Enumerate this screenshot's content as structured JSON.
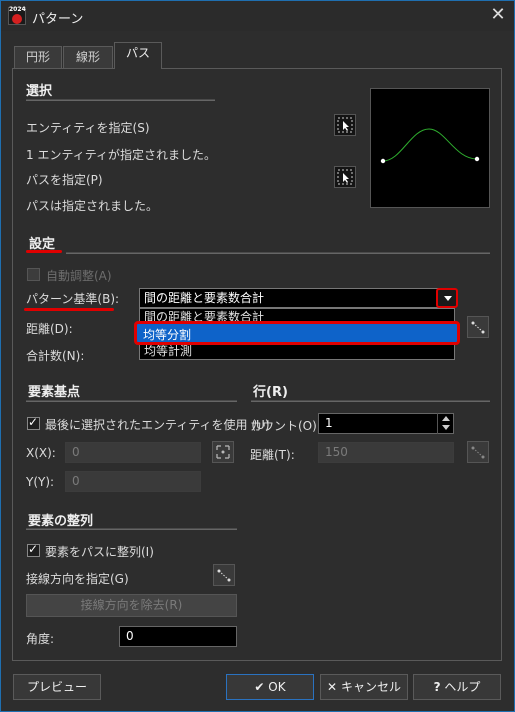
{
  "window": {
    "title": "パターン",
    "app_year": "2024"
  },
  "tabs": [
    {
      "label": "円形"
    },
    {
      "label": "線形"
    },
    {
      "label": "パス"
    }
  ],
  "selection": {
    "heading": "選択",
    "entity_label": "エンティティを指定(S)",
    "entity_status": "1 エンティティが指定されました。",
    "path_label": "パスを指定(P)",
    "path_status": "パスは指定されました。"
  },
  "settings": {
    "heading": "設定",
    "auto_adjust": "自動調整(A)",
    "pattern_basis_label": "パターン基準(B):",
    "pattern_basis_value": "間の距離と要素数合計",
    "options": [
      "間の距離と要素数合計",
      "均等分割",
      "均等計測"
    ],
    "highlighted_option": "均等分割",
    "distance_label": "距離(D):",
    "total_label": "合計数(N):"
  },
  "base_point": {
    "heading": "要素基点",
    "use_last": "最後に選択されたエンティティを使用 (U)",
    "x_label": "X(X):",
    "x_value": "0",
    "y_label": "Y(Y):",
    "y_value": "0"
  },
  "row": {
    "heading": "行(R)",
    "count_label": "カウント(O):",
    "count_value": "1",
    "distance_label": "距離(T):",
    "distance_value": "150"
  },
  "alignment": {
    "heading": "要素の整列",
    "align_to_path": "要素をパスに整列(I)",
    "tangent_label": "接線方向を指定(G)",
    "remove_tangent": "接線方向を除去(R)",
    "angle_label": "角度:",
    "angle_value": "0"
  },
  "buttons": {
    "preview": "プレビュー",
    "ok": "OK",
    "cancel": "キャンセル",
    "help": "ヘルプ"
  },
  "colors": {
    "accent_red": "#e00000",
    "highlight_blue": "#0e63c9",
    "curve_green": "#2fae2f"
  }
}
